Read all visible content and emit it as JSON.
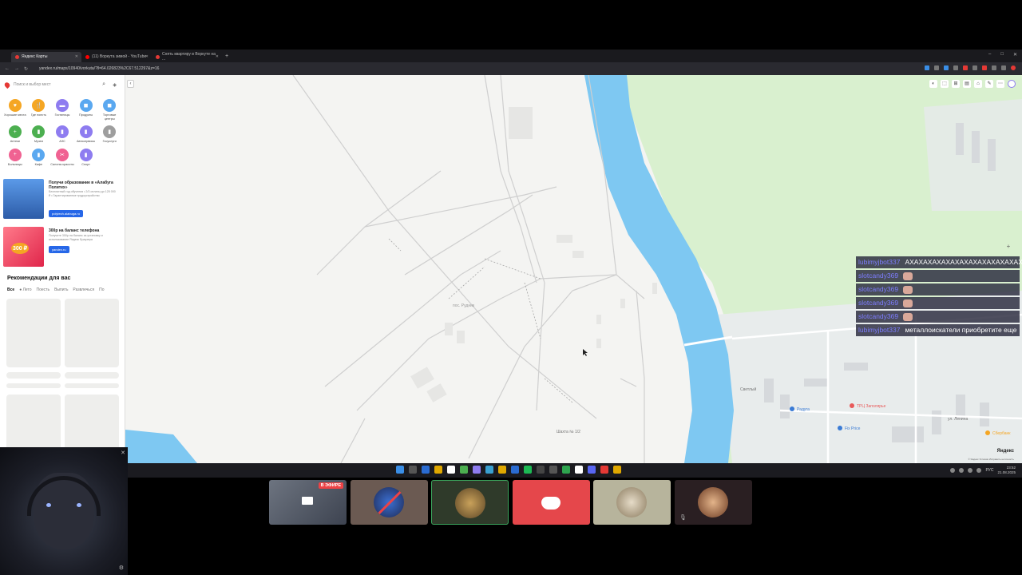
{
  "browser": {
    "tabs": [
      {
        "title": "Яндекс Карты",
        "color": "#e53935",
        "active": true
      },
      {
        "title": "(11) Воркута зимой - YouTube",
        "color": "#ff0000",
        "active": false
      },
      {
        "title": "Снять квартиру в Воркуте на ...",
        "color": "#e53935",
        "active": false
      }
    ],
    "new_tab": "+",
    "window_controls": [
      "–",
      "□",
      "✕"
    ],
    "nav": [
      "←",
      "→",
      "↻"
    ],
    "url": "yandex.ru/maps/10940/vorkuta/?ll=64.026823%2C67.512297&z=16"
  },
  "panel": {
    "search_placeholder": "Поиск и выбор мест",
    "categories": [
      {
        "label": "Хорошие места",
        "color": "#f5a623",
        "icon": "♥"
      },
      {
        "label": "Где поесть",
        "color": "#f5a623",
        "icon": "🍴"
      },
      {
        "label": "Гостиницы",
        "color": "#8e7cf0",
        "icon": "▬"
      },
      {
        "label": "Продукты",
        "color": "#5aa8f0",
        "icon": "◼"
      },
      {
        "label": "Торговые центры",
        "color": "#5aa8f0",
        "icon": "◼"
      },
      {
        "label": "Аптеки",
        "color": "#4caf50",
        "icon": "+"
      },
      {
        "label": "Музеи",
        "color": "#4caf50",
        "icon": "▮"
      },
      {
        "label": "АЗС",
        "color": "#8e7cf0",
        "icon": "▮"
      },
      {
        "label": "Автосервисы",
        "color": "#8e7cf0",
        "icon": "▮"
      },
      {
        "label": "Госуслуги",
        "color": "#9e9e9e",
        "icon": "▮"
      },
      {
        "label": "Больницы",
        "color": "#f06292",
        "icon": "+"
      },
      {
        "label": "Кафе",
        "color": "#5aa8f0",
        "icon": "▮"
      },
      {
        "label": "Салоны красоты",
        "color": "#f06292",
        "icon": "✂"
      },
      {
        "label": "Спорт",
        "color": "#8e7cf0",
        "icon": "▮"
      }
    ],
    "ads": [
      {
        "title": "Получи образование в «Алабуга Политех»",
        "text": "Бесплатный год обучения • 2/3 оплаты до 125 000 ₽ • Гарантированное трудоустройство",
        "button": "polytech.alabuga.ru",
        "thumb_color": "#3a7bd5"
      },
      {
        "title": "300р на баланс телефона",
        "text": "Получите 300р на баланс за установку и использование Яндекс Браузера",
        "button": "yandex.ru",
        "thumb_color": "#f0546a",
        "badge": "300 ₽"
      }
    ],
    "recommendations_title": "Рекомендации для вас",
    "rec_tabs": [
      "Все",
      "Лето",
      "Поесть",
      "Выпить",
      "Развлечься",
      "По"
    ]
  },
  "map": {
    "labels": {
      "place_left": "пос. Рудник",
      "mine": "Шахта № 1/2",
      "district": "Светлый",
      "street": "ул. Ленина",
      "poi1": "ТРЦ Заполярье",
      "poi2": "Радуга",
      "poi3": "Fix Price",
      "poi4": "Сбербанк"
    },
    "tools": [
      "◐",
      "⬚",
      "⊞",
      "▤",
      "⌂",
      "✎",
      "⋯"
    ],
    "zoom_in": "+",
    "zoom_out": "−",
    "brand": "Яндекс",
    "copyright": "© Яндекс  Условия  Исправить неточность"
  },
  "chat": [
    {
      "nick": "lubimyjbot337",
      "text": "АХАХАХАХАХАХАХАХАХАХАХАХАХ",
      "emote": false
    },
    {
      "nick": "slotcandy369",
      "text": "",
      "emote": true
    },
    {
      "nick": "slotcandy369",
      "text": "",
      "emote": true
    },
    {
      "nick": "slotcandy369",
      "text": "",
      "emote": true
    },
    {
      "nick": "slotcandy369",
      "text": "",
      "emote": true
    },
    {
      "nick": "lubimyjbot337",
      "text": "металлоискатели приобретите еще",
      "emote": false
    }
  ],
  "taskbar": {
    "icons": [
      "#3a8ee6",
      "#555",
      "#2a6bd1",
      "#e0a800",
      "#fff",
      "#4caf50",
      "#8e7cf0",
      "#3aa0d0",
      "#e0a800",
      "#2a6bd1",
      "#1db954",
      "#444",
      "#555",
      "#2ea44f",
      "#fff",
      "#5865f2",
      "#e53935",
      "#e0a800"
    ],
    "lang": "РУС",
    "time": "23:52",
    "date": "21.08.2025"
  },
  "call": {
    "live_label": "В ЭФИРЕ",
    "tiles": [
      {
        "bg": "#5a5a5a",
        "kind": "screen"
      },
      {
        "bg": "#6b5a52",
        "kind": "avatar-crossed"
      },
      {
        "bg": "#2f3a2a",
        "kind": "avatar-group"
      },
      {
        "bg": "#e5474b",
        "kind": "discord"
      },
      {
        "bg": "#b7b49c",
        "kind": "avatar-man"
      },
      {
        "bg": "#2a1f22",
        "kind": "avatar-woman"
      }
    ]
  }
}
